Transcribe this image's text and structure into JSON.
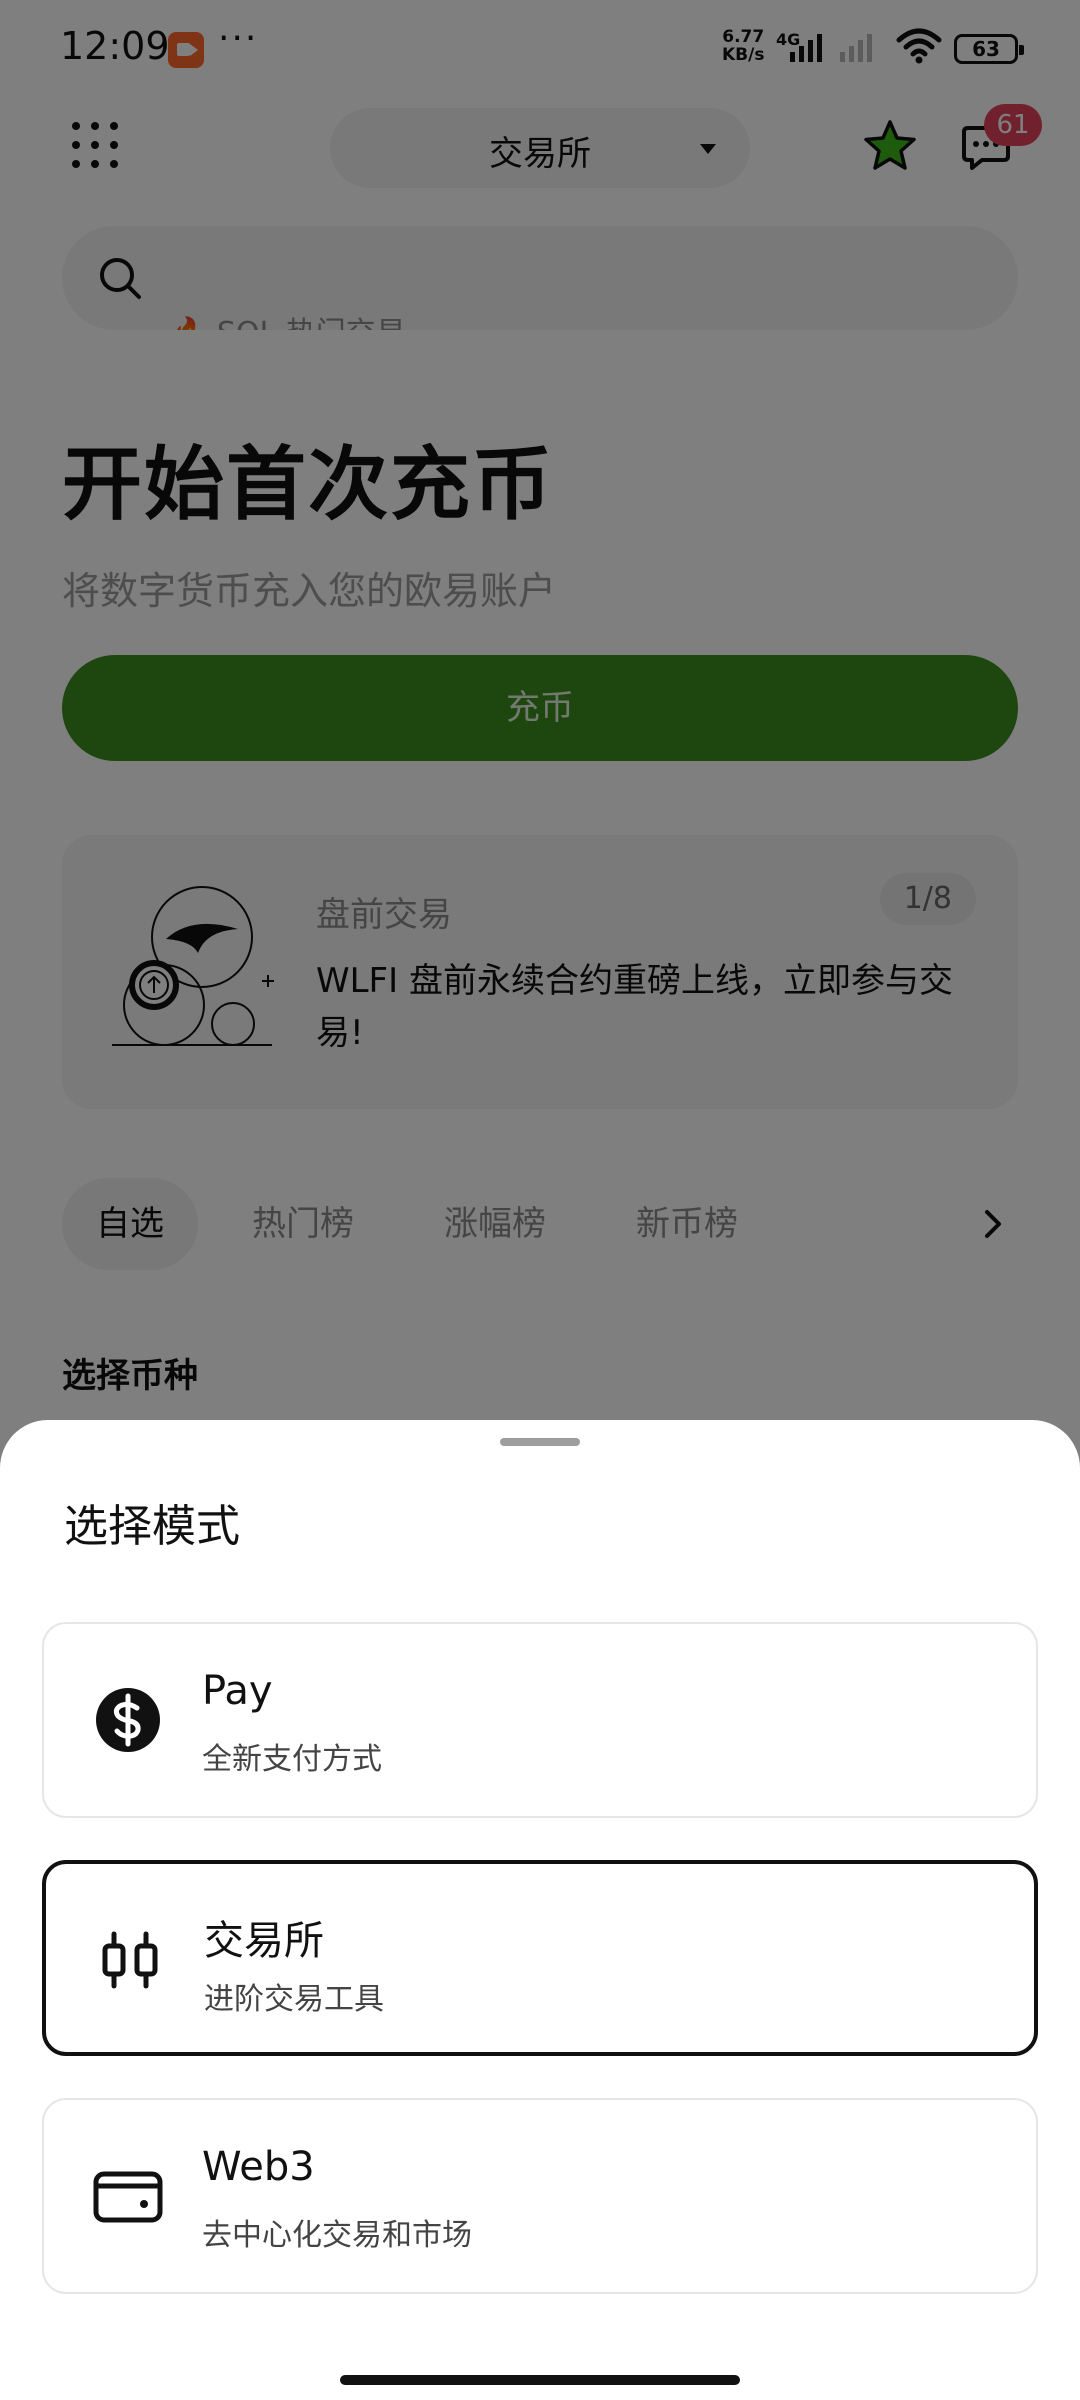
{
  "status_bar": {
    "time": "12:09",
    "dots": "···",
    "net_speed_value": "6.77",
    "net_speed_unit": "KB/s",
    "network_type": "4G",
    "battery": "63"
  },
  "header": {
    "exchange_label": "交易所",
    "message_badge": "61"
  },
  "search": {
    "hint": "🔥 SOL 热门交易"
  },
  "deposit": {
    "title": "开始首次充币",
    "subtitle": "将数字货币充入您的欧易账户",
    "button_label": "充币"
  },
  "promo": {
    "category": "盘前交易",
    "counter": "1/8",
    "text": "WLFI 盘前永续合约重磅上线，立即参与交易!"
  },
  "tabs": [
    {
      "label": "自选",
      "active": true
    },
    {
      "label": "热门榜",
      "active": false
    },
    {
      "label": "涨幅榜",
      "active": false
    },
    {
      "label": "新币榜",
      "active": false
    }
  ],
  "section_label": "选择币种",
  "sheet": {
    "title": "选择模式",
    "options": [
      {
        "name": "Pay",
        "desc": "全新支付方式",
        "icon": "dollar-icon",
        "selected": false
      },
      {
        "name": "交易所",
        "desc": "进阶交易工具",
        "icon": "candlestick-icon",
        "selected": true
      },
      {
        "name": "Web3",
        "desc": "去中心化交易和市场",
        "icon": "wallet-icon",
        "selected": false
      }
    ]
  },
  "colors": {
    "deposit_button": "#3a8f1e",
    "badge": "#e2415b",
    "star": "#3fb618",
    "recording": "#ff6a2b"
  }
}
